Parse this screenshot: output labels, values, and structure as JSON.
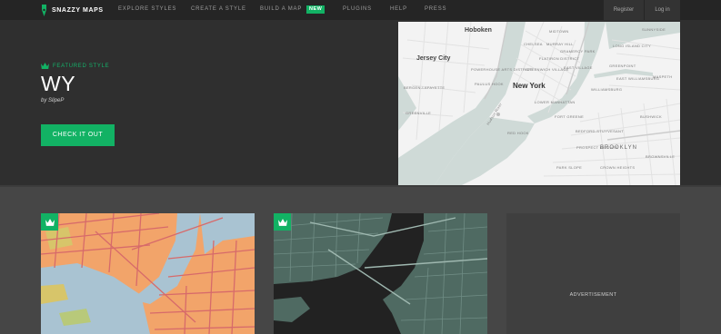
{
  "brand": {
    "name": "SNAZZY MAPS"
  },
  "nav": {
    "items": [
      {
        "label": "EXPLORE STYLES"
      },
      {
        "label": "CREATE A STYLE"
      },
      {
        "label": "BUILD A MAP"
      },
      {
        "label": "PLUGINS"
      },
      {
        "label": "HELP"
      },
      {
        "label": "PRESS"
      }
    ],
    "new_badge": "NEW",
    "register": "Register",
    "login": "Log in"
  },
  "featured": {
    "label": "FEATURED STYLE",
    "title": "WY",
    "author": "by SlipeP",
    "cta": "CHECK IT OUT",
    "map_labels": {
      "hoboken": "Hoboken",
      "jersey_city": "Jersey City",
      "new_york": "New York",
      "brooklyn": "BROOKLYN",
      "midtown": "MIDTOWN",
      "murray_hill": "MURRAY HILL",
      "gramercy": "GRAMERCY PARK",
      "flatiron": "FLATIRON DISTRICT",
      "chelsea": "CHELSEA",
      "greenwich": "GREENWICH VILLAGE",
      "east_village": "EAST VILLAGE",
      "lower_manhattan": "LOWER MANHATTAN",
      "paulus_hook": "PAULUS HOOK",
      "bergen": "BERGEN-LAFAYETTE",
      "greenville": "GREENVILLE",
      "powerhouse": "POWERHOUSE ARTS DISTRICT",
      "williamsburg": "WILLIAMSBURG",
      "greenpoint": "GREENPOINT",
      "east_williamsburg": "EAST WILLIAMSBURG",
      "bed_stuy": "BEDFORD-STUYVESANT",
      "crown_heights": "CROWN HEIGHTS",
      "park_slope": "PARK SLOPE",
      "prospect": "PROSPECT HEIGHTS",
      "red_hook": "RED HOOK",
      "fort_greene": "FORT GREENE",
      "bushwick": "BUSHWICK",
      "long_island_city": "LONG ISLAND CITY",
      "sunnyside": "SUNNYSIDE",
      "brownsville": "BROWNSVILLE",
      "maspeth": "MASPETH",
      "river": "Hudson River"
    }
  },
  "advertisement": {
    "label": "ADVERTISEMENT"
  },
  "colors": {
    "accent": "#12b264",
    "nav_bg": "#252525",
    "hero_bg": "#2f2f2f",
    "page_bg": "#464646",
    "water_featured": "#cdd9d6",
    "land_featured": "#f4f4f4",
    "card1_land": "#f2a46a",
    "card1_water": "#a9c3d2",
    "card2_land": "#4f6a62",
    "card2_water": "#222222"
  }
}
